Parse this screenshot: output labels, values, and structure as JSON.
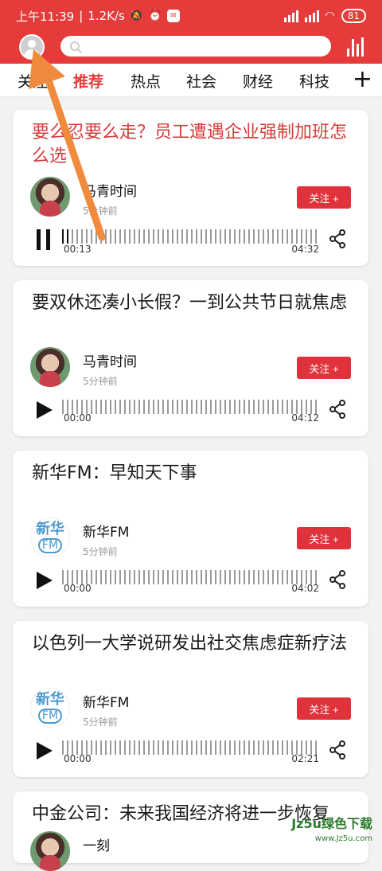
{
  "status_bar": {
    "time": "上午11:39",
    "speed": "1.2K/s",
    "battery": "81"
  },
  "header": {
    "search_placeholder": ""
  },
  "tabs": [
    {
      "label": "关注"
    },
    {
      "label": "推荐"
    },
    {
      "label": "热点"
    },
    {
      "label": "社会"
    },
    {
      "label": "财经"
    },
    {
      "label": "科技"
    }
  ],
  "active_tab_index": 1,
  "cards": [
    {
      "title": "要么忍要么走？员工遭遇企业强制加班怎么选",
      "author": "马青时间",
      "time": "5分钟前",
      "follow": "关注 +",
      "current": "00:13",
      "duration": "04:32",
      "playing": true,
      "title_color": "#d63b3b"
    },
    {
      "title": "要双休还凑小长假？一到公共节日就焦虑",
      "author": "马青时间",
      "time": "5分钟前",
      "follow": "关注 +",
      "current": "00:00",
      "duration": "04:12",
      "playing": false
    },
    {
      "title": "新华FM：早知天下事",
      "author": "新华FM",
      "time": "5分钟前",
      "follow": "关注 +",
      "current": "00:00",
      "duration": "04:02",
      "playing": false
    },
    {
      "title": "以色列一大学说研发出社交焦虑症新疗法",
      "author": "新华FM",
      "time": "5分钟前",
      "follow": "关注 +",
      "current": "00:00",
      "duration": "02:21",
      "playing": false
    },
    {
      "title": "中金公司：未来我国经济将进一步恢复",
      "author": "一刻"
    }
  ],
  "xinhua_logo": {
    "line1": "新华",
    "line2": "FM"
  },
  "watermark": {
    "line1": "Jz5u绿色下载",
    "line2": "www.Jz5u.com"
  },
  "colors": {
    "brand_red": "#e53b3b",
    "follow_red": "#e0323a",
    "arrow_orange": "#f08a3c"
  }
}
